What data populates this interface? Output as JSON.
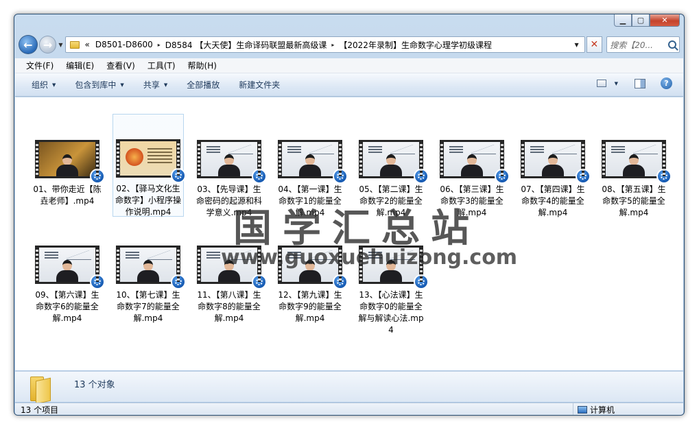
{
  "window": {
    "controls": {
      "minimize": "▁",
      "maximize": "▢",
      "close": "✕"
    }
  },
  "address": {
    "prefix": "«",
    "crumbs": [
      "D8501-D8600",
      "D8584 【大天使】生命译码联盟最新高级课",
      "【2022年录制】生命数字心理学初级课程"
    ],
    "separator": "▸",
    "search_placeholder": "搜索【20..."
  },
  "menu": [
    "文件(F)",
    "编辑(E)",
    "查看(V)",
    "工具(T)",
    "帮助(H)"
  ],
  "toolbar": {
    "organize": "组织",
    "include_in_library": "包含到库中",
    "share": "共享",
    "play_all": "全部播放",
    "new_folder": "新建文件夹"
  },
  "files": [
    {
      "name": "01、带你走近【陈垚老师】.mp4",
      "thumb": "gold"
    },
    {
      "name": "02、【驿马文化生命数字】小程序操作说明.mp4",
      "thumb": "doc"
    },
    {
      "name": "03、【先导课】生命密码的起源和科学意义.mp4",
      "thumb": "class"
    },
    {
      "name": "04、【第一课】生命数字1的能量全解.mp4",
      "thumb": "class"
    },
    {
      "name": "05、【第二课】生命数字2的能量全解.mp4",
      "thumb": "class"
    },
    {
      "name": "06、【第三课】生命数字3的能量全解.mp4",
      "thumb": "class"
    },
    {
      "name": "07、【第四课】生命数字4的能量全解.mp4",
      "thumb": "class"
    },
    {
      "name": "08、【第五课】生命数字5的能量全解.mp4",
      "thumb": "class"
    },
    {
      "name": "09、【第六课】生命数字6的能量全解.mp4",
      "thumb": "class"
    },
    {
      "name": "10、【第七课】生命数字7的能量全解.mp4",
      "thumb": "class"
    },
    {
      "name": "11、【第八课】生命数字8的能量全解.mp4",
      "thumb": "class"
    },
    {
      "name": "12、【第九课】生命数字9的能量全解.mp4",
      "thumb": "class"
    },
    {
      "name": "13、【心法课】生命数字0的能量全解与解读心法.mp4",
      "thumb": "class"
    }
  ],
  "watermark": {
    "text": "国学汇总站",
    "url": "www.guoxuehuizong.com"
  },
  "details": {
    "count": "13 个对象"
  },
  "status": {
    "items": "13 个项目",
    "location": "计算机"
  },
  "colors": {
    "accent": "#2a6ab7",
    "badge": "#1458b0"
  }
}
